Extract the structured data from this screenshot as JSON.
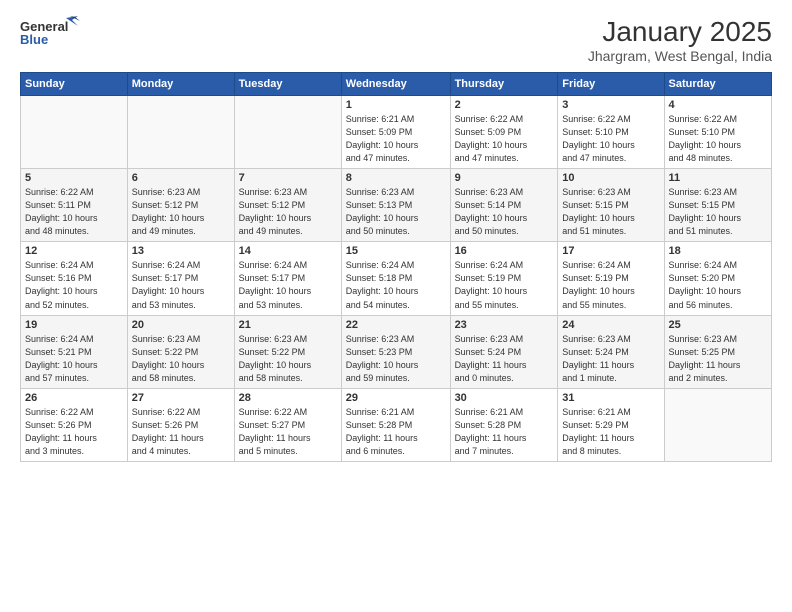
{
  "header": {
    "logo_line1": "General",
    "logo_line2": "Blue",
    "title": "January 2025",
    "subtitle": "Jhargram, West Bengal, India"
  },
  "weekdays": [
    "Sunday",
    "Monday",
    "Tuesday",
    "Wednesday",
    "Thursday",
    "Friday",
    "Saturday"
  ],
  "weeks": [
    [
      {
        "day": "",
        "info": ""
      },
      {
        "day": "",
        "info": ""
      },
      {
        "day": "",
        "info": ""
      },
      {
        "day": "1",
        "info": "Sunrise: 6:21 AM\nSunset: 5:09 PM\nDaylight: 10 hours\nand 47 minutes."
      },
      {
        "day": "2",
        "info": "Sunrise: 6:22 AM\nSunset: 5:09 PM\nDaylight: 10 hours\nand 47 minutes."
      },
      {
        "day": "3",
        "info": "Sunrise: 6:22 AM\nSunset: 5:10 PM\nDaylight: 10 hours\nand 47 minutes."
      },
      {
        "day": "4",
        "info": "Sunrise: 6:22 AM\nSunset: 5:10 PM\nDaylight: 10 hours\nand 48 minutes."
      }
    ],
    [
      {
        "day": "5",
        "info": "Sunrise: 6:22 AM\nSunset: 5:11 PM\nDaylight: 10 hours\nand 48 minutes."
      },
      {
        "day": "6",
        "info": "Sunrise: 6:23 AM\nSunset: 5:12 PM\nDaylight: 10 hours\nand 49 minutes."
      },
      {
        "day": "7",
        "info": "Sunrise: 6:23 AM\nSunset: 5:12 PM\nDaylight: 10 hours\nand 49 minutes."
      },
      {
        "day": "8",
        "info": "Sunrise: 6:23 AM\nSunset: 5:13 PM\nDaylight: 10 hours\nand 50 minutes."
      },
      {
        "day": "9",
        "info": "Sunrise: 6:23 AM\nSunset: 5:14 PM\nDaylight: 10 hours\nand 50 minutes."
      },
      {
        "day": "10",
        "info": "Sunrise: 6:23 AM\nSunset: 5:15 PM\nDaylight: 10 hours\nand 51 minutes."
      },
      {
        "day": "11",
        "info": "Sunrise: 6:23 AM\nSunset: 5:15 PM\nDaylight: 10 hours\nand 51 minutes."
      }
    ],
    [
      {
        "day": "12",
        "info": "Sunrise: 6:24 AM\nSunset: 5:16 PM\nDaylight: 10 hours\nand 52 minutes."
      },
      {
        "day": "13",
        "info": "Sunrise: 6:24 AM\nSunset: 5:17 PM\nDaylight: 10 hours\nand 53 minutes."
      },
      {
        "day": "14",
        "info": "Sunrise: 6:24 AM\nSunset: 5:17 PM\nDaylight: 10 hours\nand 53 minutes."
      },
      {
        "day": "15",
        "info": "Sunrise: 6:24 AM\nSunset: 5:18 PM\nDaylight: 10 hours\nand 54 minutes."
      },
      {
        "day": "16",
        "info": "Sunrise: 6:24 AM\nSunset: 5:19 PM\nDaylight: 10 hours\nand 55 minutes."
      },
      {
        "day": "17",
        "info": "Sunrise: 6:24 AM\nSunset: 5:19 PM\nDaylight: 10 hours\nand 55 minutes."
      },
      {
        "day": "18",
        "info": "Sunrise: 6:24 AM\nSunset: 5:20 PM\nDaylight: 10 hours\nand 56 minutes."
      }
    ],
    [
      {
        "day": "19",
        "info": "Sunrise: 6:24 AM\nSunset: 5:21 PM\nDaylight: 10 hours\nand 57 minutes."
      },
      {
        "day": "20",
        "info": "Sunrise: 6:23 AM\nSunset: 5:22 PM\nDaylight: 10 hours\nand 58 minutes."
      },
      {
        "day": "21",
        "info": "Sunrise: 6:23 AM\nSunset: 5:22 PM\nDaylight: 10 hours\nand 58 minutes."
      },
      {
        "day": "22",
        "info": "Sunrise: 6:23 AM\nSunset: 5:23 PM\nDaylight: 10 hours\nand 59 minutes."
      },
      {
        "day": "23",
        "info": "Sunrise: 6:23 AM\nSunset: 5:24 PM\nDaylight: 11 hours\nand 0 minutes."
      },
      {
        "day": "24",
        "info": "Sunrise: 6:23 AM\nSunset: 5:24 PM\nDaylight: 11 hours\nand 1 minute."
      },
      {
        "day": "25",
        "info": "Sunrise: 6:23 AM\nSunset: 5:25 PM\nDaylight: 11 hours\nand 2 minutes."
      }
    ],
    [
      {
        "day": "26",
        "info": "Sunrise: 6:22 AM\nSunset: 5:26 PM\nDaylight: 11 hours\nand 3 minutes."
      },
      {
        "day": "27",
        "info": "Sunrise: 6:22 AM\nSunset: 5:26 PM\nDaylight: 11 hours\nand 4 minutes."
      },
      {
        "day": "28",
        "info": "Sunrise: 6:22 AM\nSunset: 5:27 PM\nDaylight: 11 hours\nand 5 minutes."
      },
      {
        "day": "29",
        "info": "Sunrise: 6:21 AM\nSunset: 5:28 PM\nDaylight: 11 hours\nand 6 minutes."
      },
      {
        "day": "30",
        "info": "Sunrise: 6:21 AM\nSunset: 5:28 PM\nDaylight: 11 hours\nand 7 minutes."
      },
      {
        "day": "31",
        "info": "Sunrise: 6:21 AM\nSunset: 5:29 PM\nDaylight: 11 hours\nand 8 minutes."
      },
      {
        "day": "",
        "info": ""
      }
    ]
  ]
}
